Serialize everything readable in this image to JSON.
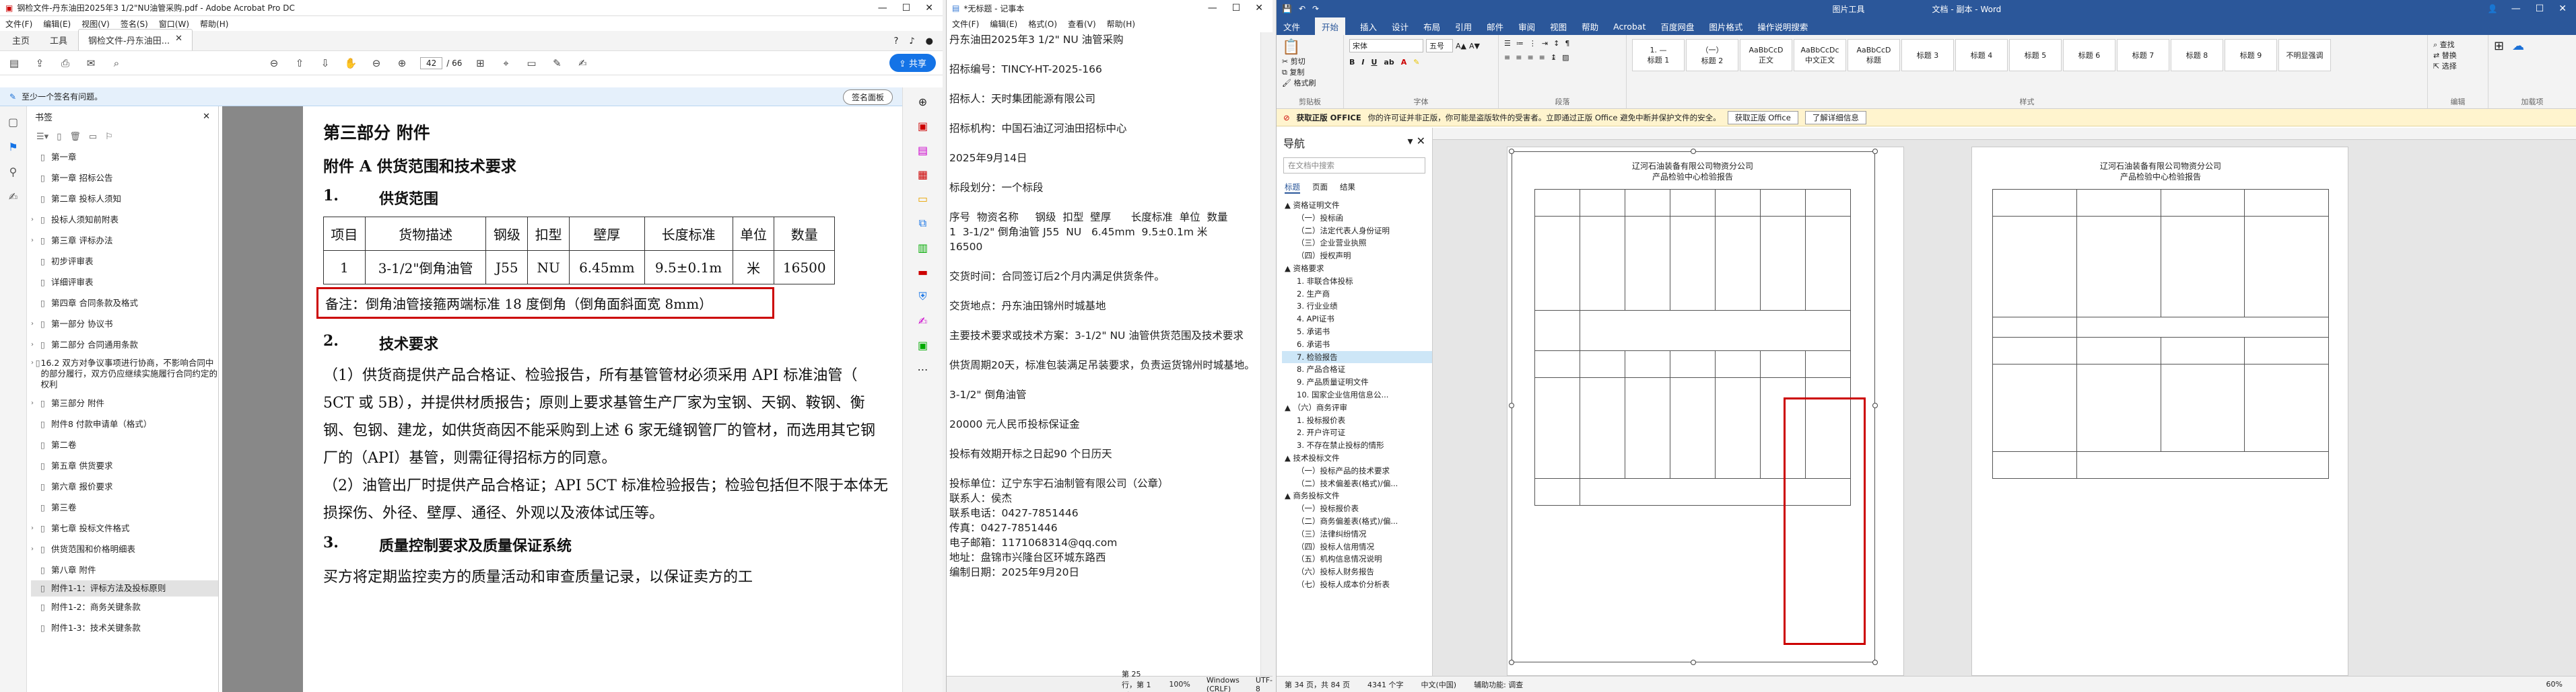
{
  "acrobat": {
    "title": "钢检文件-丹东油田2025年3 1/2\"NU油管采购.pdf - Adobe Acrobat Pro DC",
    "menu": [
      "文件(F)",
      "编辑(E)",
      "视图(V)",
      "签名(S)",
      "窗口(W)",
      "帮助(H)"
    ],
    "tabs": {
      "home": "主页",
      "tools": "工具",
      "doc": "钢检文件-丹东油田..."
    },
    "page_current": "42",
    "page_total": "/ 66",
    "share_label": "共享",
    "sig_message": "至少一个签名有问题。",
    "sig_button": "签名面板",
    "bookmarks_title": "书签",
    "bookmarks": [
      {
        "text": "第一章",
        "tw": ""
      },
      {
        "text": "第一章  招标公告",
        "tw": ""
      },
      {
        "text": "第二章  投标人须知",
        "tw": ""
      },
      {
        "text": "投标人须知前附表",
        "tw": "›"
      },
      {
        "text": "第三章  评标办法",
        "tw": "›"
      },
      {
        "text": "初步评审表",
        "tw": ""
      },
      {
        "text": "详细评审表",
        "tw": ""
      },
      {
        "text": "第四章  合同条款及格式",
        "tw": ""
      },
      {
        "text": "第一部分 协议书",
        "tw": "›"
      },
      {
        "text": "第二部分 合同通用条款",
        "tw": "›"
      },
      {
        "text": "16.2 双方对争议事项进行协商，不影响合同中的部分履行，双方仍应继续实施履行合同约定的权利",
        "tw": "›",
        "wrap": true
      },
      {
        "text": "第三部分 附件",
        "tw": "›"
      },
      {
        "text": "附件8 付款申请单（格式）",
        "tw": ""
      },
      {
        "text": "第二卷",
        "tw": ""
      },
      {
        "text": "第五章  供货要求",
        "tw": ""
      },
      {
        "text": "第六章  报价要求",
        "tw": ""
      },
      {
        "text": "第三卷",
        "tw": ""
      },
      {
        "text": "第七章  投标文件格式",
        "tw": "›"
      },
      {
        "text": "供货范围和价格明细表",
        "tw": "›"
      },
      {
        "text": "第八章  附件",
        "tw": ""
      },
      {
        "text": "附件1-1：评标方法及投标原则",
        "tw": "",
        "sel": true,
        "wrap": true
      },
      {
        "text": "附件1-2：商务关键条款",
        "tw": ""
      },
      {
        "text": "附件1-3：技术关键条款",
        "tw": ""
      }
    ],
    "pdf": {
      "part_title": "第三部分  附件",
      "annex_title": "附件 A  供货范围和技术要求",
      "sec1_num": "1.",
      "sec1_title": "供货范围",
      "table_headers": [
        "项目",
        "货物描述",
        "钢级",
        "扣型",
        "壁厚",
        "长度标准",
        "单位",
        "数量"
      ],
      "table_row": [
        "1",
        "3-1/2\"倒角油管",
        "J55",
        "NU",
        "6.45mm",
        "9.5±0.1m",
        "米",
        "16500"
      ],
      "note": "备注：倒角油管接箍两端标准 18 度倒角（倒角面斜面宽 8mm）",
      "sec2_num": "2.",
      "sec2_title": "技术要求",
      "p1": "（1）供货商提供产品合格证、检验报告，所有基管管材必须采用 API 标准油管（  5CT 或 5B），并提供材质报告；原则上要求基管生产厂家为宝钢、天钢、鞍钢、衡钢、包钢、建龙，如供货商因不能采购到上述 6 家无缝钢管厂的管材，而选用其它钢厂的（API）基管，则需征得招标方的同意。",
      "p2": "（2）油管出厂时提供产品合格证；API 5CT 标准检验报告；检验包括但不限于本体无损探伤、外径、壁厚、通径、外观以及液体试压等。",
      "sec3_num": "3.",
      "sec3_title": "质量控制要求及质量保证系统",
      "p3": "买方将定期监控卖方的质量活动和审查质量记录，以保证卖方的工"
    }
  },
  "notepad": {
    "title": "*无标题 - 记事本",
    "menu": [
      "文件(F)",
      "编辑(E)",
      "格式(O)",
      "查看(V)",
      "帮助(H)"
    ],
    "lines": [
      "丹东油田2025年3 1/2\" NU 油管采购",
      "",
      "招标编号：TINCY-HT-2025-166",
      "",
      "招标人：天时集团能源有限公司",
      "",
      "招标机构：中国石油辽河油田招标中心",
      "",
      "2025年9月14日",
      "",
      "标段划分：一个标段",
      "",
      "序号  物资名称     钢级  扣型  壁厚      长度标准  单位  数量",
      "1  3-1/2\" 倒角油管 J55  NU   6.45mm  9.5±0.1m 米      16500",
      "",
      "交货时间：合同签订后2个月内满足供货条件。",
      "",
      "交货地点：丹东油田锦州时城基地",
      "",
      "主要技术要求或技术方案：3-1/2\" NU 油管供货范围及技术要求",
      "",
      "供货周期20天，标准包装满足吊装要求，负责运货锦州时城基地。",
      "",
      "3-1/2\" 倒角油管",
      "",
      "20000 元人民币投标保证金",
      "",
      "投标有效期开标之日起90 个日历天",
      "",
      "投标单位：辽宁东宇石油制管有限公司（公章）",
      "联系人：侯杰",
      "联系电话：0427-7851446",
      "传真：0427-7851446",
      "电子邮箱：1171068314@qq.com",
      "地址：盘锦市兴隆台区环城东路西",
      "编制日期：2025年9月20日"
    ],
    "status": [
      "第 25 行，第 1 列",
      "100%",
      "Windows (CRLF)",
      "UTF-8"
    ]
  },
  "word": {
    "title": "文档 - 副本 - Word",
    "title_right": "图片工具",
    "tabs": [
      "文件",
      "开始",
      "插入",
      "设计",
      "布局",
      "引用",
      "邮件",
      "审阅",
      "视图",
      "帮助",
      "Acrobat",
      "百度网盘",
      "图片格式",
      "操作说明搜索"
    ],
    "font_name": "宋体",
    "font_size": "五号",
    "styles": [
      "1. —",
      "（一）",
      "AaBbCcD",
      "AaBbCcDc",
      "AaBbCcD",
      "标题 3",
      "标题 4",
      "标题 5",
      "标题 6",
      "标题 7",
      "标题 8",
      "标题 9",
      "不明显强调"
    ],
    "style_names": [
      "标题 1",
      "标题 2",
      "正文",
      "中文正文",
      "标题",
      "",
      "",
      "",
      "",
      "",
      "",
      "",
      ""
    ],
    "group_labels": [
      "剪贴板",
      "字体",
      "段落",
      "样式",
      "编辑",
      "加载项"
    ],
    "msg_label": "获取正版 OFFICE",
    "msg_text": "你的许可证并非正版，你可能是盗版软件的受害者。立即通过正版 Office 避免中断并保护文件的安全。",
    "msg_btn1": "获取正版 Office",
    "msg_btn2": "了解详细信息",
    "nav_title": "导航",
    "nav_search": "在文档中搜索",
    "nav_tabs": [
      "标题",
      "页面",
      "结果"
    ],
    "nav_items": [
      {
        "t": "▲ 资格证明文件",
        "c": "l1"
      },
      {
        "t": "（一）投标函",
        "c": "l2"
      },
      {
        "t": "（二）法定代表人身份证明",
        "c": "l2"
      },
      {
        "t": "（三）企业营业执照",
        "c": "l2"
      },
      {
        "t": "（四）授权声明",
        "c": "l2"
      },
      {
        "t": "▲ 资格要求",
        "c": "l1"
      },
      {
        "t": "1. 非联合体投标",
        "c": "l2"
      },
      {
        "t": "2. 生产商",
        "c": "l2"
      },
      {
        "t": "3. 行业业绩",
        "c": "l2"
      },
      {
        "t": "4. API证书",
        "c": "l2"
      },
      {
        "t": "5. 承诺书",
        "c": "l2"
      },
      {
        "t": "6. 承诺书",
        "c": "l2"
      },
      {
        "t": "7. 检验报告",
        "c": "l2",
        "sel": true
      },
      {
        "t": "8. 产品合格证",
        "c": "l2"
      },
      {
        "t": "9. 产品质量证明文件",
        "c": "l2"
      },
      {
        "t": "10. 国家企业信用信息公...",
        "c": "l2"
      },
      {
        "t": "▲ （六）商务评审",
        "c": "l1"
      },
      {
        "t": "1. 投标报价表",
        "c": "l2"
      },
      {
        "t": "2. 开户许可证",
        "c": "l2"
      },
      {
        "t": "3. 不存在禁止投标的情形",
        "c": "l2"
      },
      {
        "t": "▲ 技术投标文件",
        "c": "l1"
      },
      {
        "t": "（一）投标产品的技术要求",
        "c": "l2"
      },
      {
        "t": "（二）技术偏差表(格式)/偏...",
        "c": "l2"
      },
      {
        "t": "▲ 商务投标文件",
        "c": "l1"
      },
      {
        "t": "（一）投标报价表",
        "c": "l2"
      },
      {
        "t": "（二）商务偏差表(格式)/偏...",
        "c": "l2"
      },
      {
        "t": "（三）法律纠纷情况",
        "c": "l2"
      },
      {
        "t": "（四）投标人信用情况",
        "c": "l2"
      },
      {
        "t": "（五）机构信息情况说明",
        "c": "l2"
      },
      {
        "t": "（六）投标人财务报告",
        "c": "l2"
      },
      {
        "t": "（七）投标人成本价分析表",
        "c": "l2"
      }
    ],
    "cert": {
      "company": "辽河石油装备有限公司物资分公司",
      "center": "产品检验中心检验报告"
    },
    "status": [
      "第 34 页，共 84 页",
      "4341 个字",
      "中文(中国)",
      "辅助功能: 调查"
    ],
    "zoom": "60%"
  }
}
